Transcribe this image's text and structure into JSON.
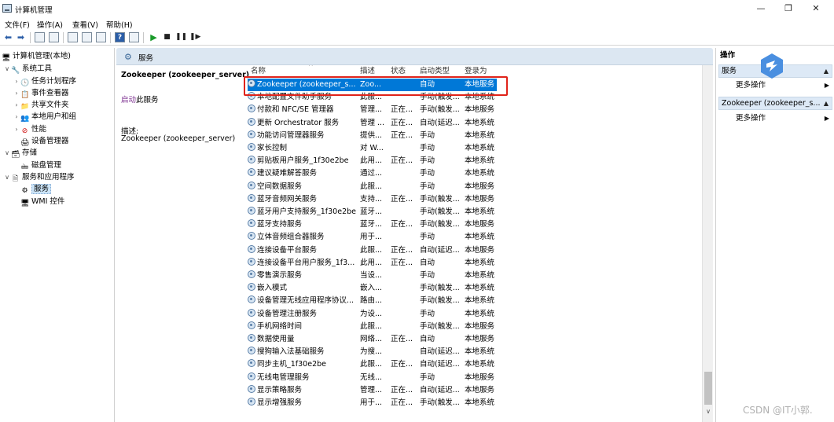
{
  "window": {
    "title": "计算机管理",
    "minimize": "—",
    "maximize": "❐",
    "close": "✕"
  },
  "menu": [
    "文件(F)",
    "操作(A)",
    "查看(V)",
    "帮助(H)"
  ],
  "tree": {
    "root": "计算机管理(本地)",
    "system_tools": "系统工具",
    "task_scheduler": "任务计划程序",
    "event_viewer": "事件查看器",
    "shared_folders": "共享文件夹",
    "local_users": "本地用户和组",
    "performance": "性能",
    "device_manager": "设备管理器",
    "storage": "存储",
    "disk_management": "磁盘管理",
    "services_apps": "服务和应用程序",
    "services": "服务",
    "wmi": "WMI 控件"
  },
  "center": {
    "header": "服务",
    "detail": {
      "title": "Zookeeper (zookeeper_server)",
      "start_link": "启动",
      "start_suffix": "此服务",
      "desc_label": "描述:",
      "desc": "Zookeeper (zookeeper_server)"
    },
    "columns": {
      "name": "名称",
      "desc": "描述",
      "status": "状态",
      "startup": "启动类型",
      "logon": "登录为"
    },
    "rows": [
      {
        "name": "Zookeeper (zookeeper_s...",
        "desc": "Zoo...",
        "status": "",
        "startup": "自动",
        "logon": "本地服务"
      },
      {
        "name": "本地配置文件助手服务",
        "desc": "此服...",
        "status": "",
        "startup": "手动(触发...",
        "logon": "本地系统"
      },
      {
        "name": "付款和 NFC/SE 管理器",
        "desc": "管理...",
        "status": "正在...",
        "startup": "手动(触发...",
        "logon": "本地服务"
      },
      {
        "name": "更新 Orchestrator 服务",
        "desc": "管理 ...",
        "status": "正在...",
        "startup": "自动(延迟...",
        "logon": "本地系统"
      },
      {
        "name": "功能访问管理器服务",
        "desc": "提供...",
        "status": "正在...",
        "startup": "手动",
        "logon": "本地系统"
      },
      {
        "name": "家长控制",
        "desc": "对 W...",
        "status": "",
        "startup": "手动",
        "logon": "本地系统"
      },
      {
        "name": "剪贴板用户服务_1f30e2be",
        "desc": "此用...",
        "status": "正在...",
        "startup": "手动",
        "logon": "本地系统"
      },
      {
        "name": "建议疑难解答服务",
        "desc": "通过...",
        "status": "",
        "startup": "手动",
        "logon": "本地系统"
      },
      {
        "name": "空间数据服务",
        "desc": "此服...",
        "status": "",
        "startup": "手动",
        "logon": "本地服务"
      },
      {
        "name": "蓝牙音频网关服务",
        "desc": "支持...",
        "status": "正在...",
        "startup": "手动(触发...",
        "logon": "本地服务"
      },
      {
        "name": "蓝牙用户支持服务_1f30e2be",
        "desc": "蓝牙...",
        "status": "",
        "startup": "手动(触发...",
        "logon": "本地系统"
      },
      {
        "name": "蓝牙支持服务",
        "desc": "蓝牙...",
        "status": "正在...",
        "startup": "手动(触发...",
        "logon": "本地服务"
      },
      {
        "name": "立体音频组合器服务",
        "desc": "用于...",
        "status": "",
        "startup": "手动",
        "logon": "本地系统"
      },
      {
        "name": "连接设备平台服务",
        "desc": "此服...",
        "status": "正在...",
        "startup": "自动(延迟...",
        "logon": "本地服务"
      },
      {
        "name": "连接设备平台用户服务_1f3...",
        "desc": "此用...",
        "status": "正在...",
        "startup": "自动",
        "logon": "本地系统"
      },
      {
        "name": "零售演示服务",
        "desc": "当设...",
        "status": "",
        "startup": "手动",
        "logon": "本地系统"
      },
      {
        "name": "嵌入模式",
        "desc": "嵌入...",
        "status": "",
        "startup": "手动(触发...",
        "logon": "本地系统"
      },
      {
        "name": "设备管理无线应用程序协议...",
        "desc": "路由...",
        "status": "",
        "startup": "手动(触发...",
        "logon": "本地系统"
      },
      {
        "name": "设备管理注册服务",
        "desc": "为设...",
        "status": "",
        "startup": "手动",
        "logon": "本地系统"
      },
      {
        "name": "手机网络时间",
        "desc": "此服...",
        "status": "",
        "startup": "手动(触发...",
        "logon": "本地服务"
      },
      {
        "name": "数据使用量",
        "desc": "网络...",
        "status": "正在...",
        "startup": "自动",
        "logon": "本地服务"
      },
      {
        "name": "搜狗输入法基础服务",
        "desc": "为搜...",
        "status": "",
        "startup": "自动(延迟...",
        "logon": "本地系统"
      },
      {
        "name": "同步主机_1f30e2be",
        "desc": "此服...",
        "status": "正在...",
        "startup": "自动(延迟...",
        "logon": "本地系统"
      },
      {
        "name": "无线电管理服务",
        "desc": "无线...",
        "status": "",
        "startup": "手动",
        "logon": "本地服务"
      },
      {
        "name": "显示策略服务",
        "desc": "管理...",
        "status": "正在...",
        "startup": "自动(延迟...",
        "logon": "本地服务"
      },
      {
        "name": "显示增强服务",
        "desc": "用于...",
        "status": "正在...",
        "startup": "手动(触发...",
        "logon": "本地系统"
      }
    ]
  },
  "actions": {
    "header": "操作",
    "section1": "服务",
    "more1": "更多操作",
    "section2": "Zookeeper (zookeeper_s...",
    "more2": "更多操作"
  },
  "watermark": "CSDN @IT小郭."
}
